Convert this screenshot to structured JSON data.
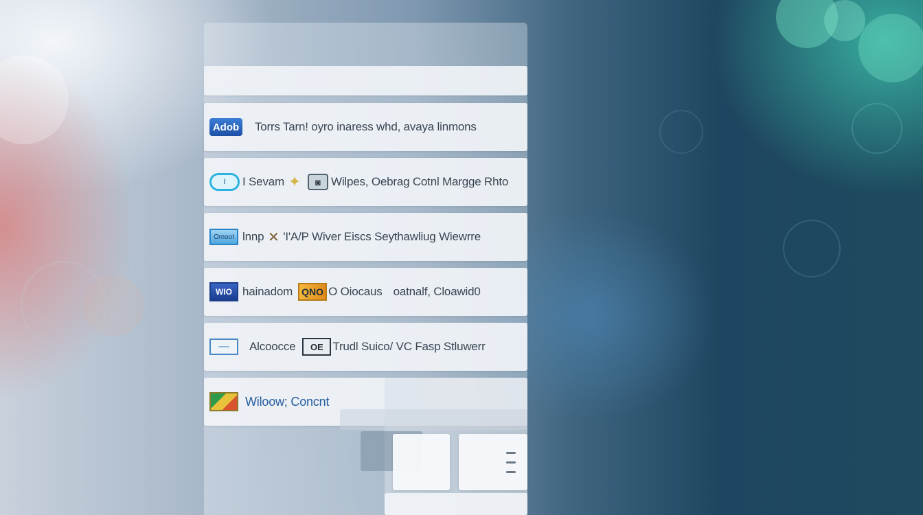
{
  "colors": {
    "background_left": "#c8d1dc",
    "background_right": "#1d4a5e",
    "row_background": "#f0f3f7",
    "row_text": "#3a4552",
    "link_text": "#275e9d",
    "accent_teal": "#3cbeaa"
  },
  "search": {
    "placeholder": ""
  },
  "rows": [
    {
      "icons": [
        {
          "name": "app-logo-icon",
          "text": "Adob"
        }
      ],
      "text": "Torrs Tarn! oyro inaress whd, avaya linmons"
    },
    {
      "icons": [
        {
          "name": "pill-app-icon",
          "text": "I"
        },
        {
          "name": "sparkle-icon",
          "text": "✦"
        },
        {
          "name": "window-app-icon",
          "text": "◙"
        }
      ],
      "segments": [
        "I Sevam",
        "Wilpes, Oebrag Cotnl Margge Rhto"
      ]
    },
    {
      "icons": [
        {
          "name": "rect-app-icon",
          "text": "Omoot"
        },
        {
          "name": "close-icon",
          "text": "✕"
        }
      ],
      "segments": [
        "lnnp",
        "'I'A/P Wiver Eiscs Seythawliug Wiewrre"
      ]
    },
    {
      "icons": [
        {
          "name": "blue-app-icon",
          "text": "WIO"
        },
        {
          "name": "orange-app-icon",
          "text": "QNO"
        }
      ],
      "segments": [
        "hainadom",
        "O Oiocaus",
        "oatnalf, Cloawid0"
      ]
    },
    {
      "icons": [
        {
          "name": "outline-app-icon",
          "text": "—"
        },
        {
          "name": "dark-app-icon",
          "text": "OE"
        }
      ],
      "segments": [
        "Alcoocce",
        "Trudl Suico/ VC Fasp Stluwerr"
      ]
    },
    {
      "icons": [
        {
          "name": "folder-app-icon",
          "text": ""
        }
      ],
      "text": "Wiloow; Concnt"
    }
  ]
}
